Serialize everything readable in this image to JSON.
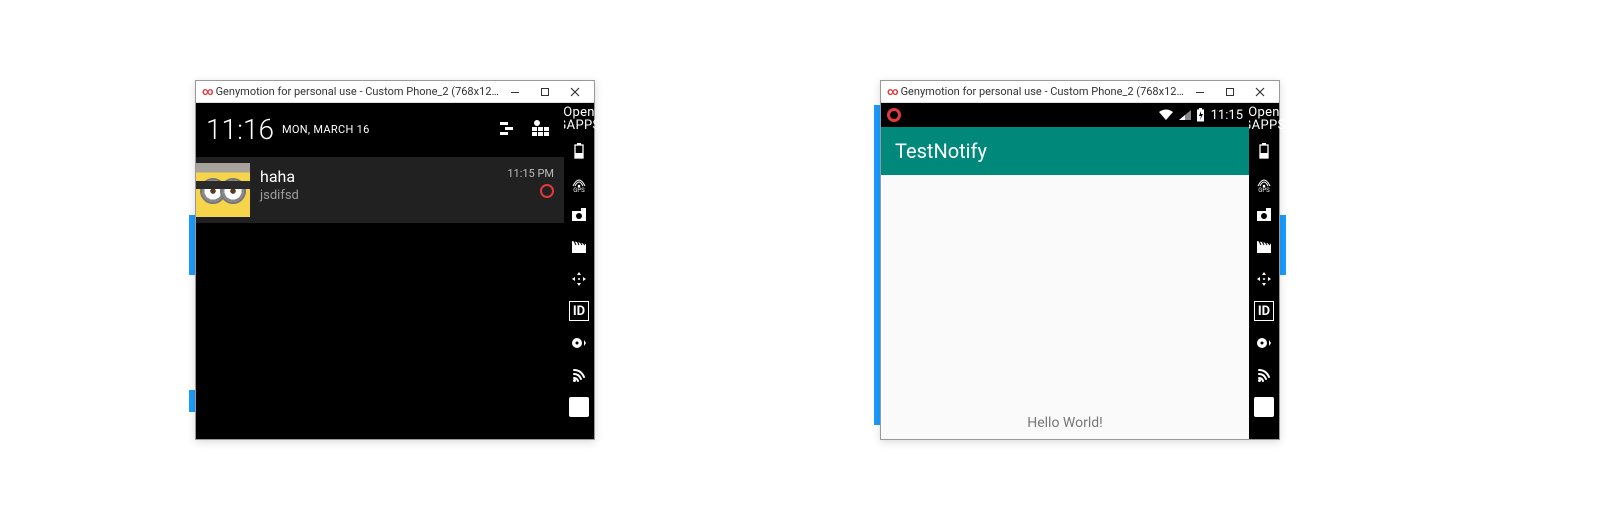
{
  "windowTitle": "Genymotion for personal use - Custom Phone_2 (768x1280, 320dp...",
  "left": {
    "time": "11:16",
    "date": "MON, MARCH 16",
    "notification": {
      "title": "haha",
      "text": "jsdifsd",
      "time": "11:15 PM"
    }
  },
  "right": {
    "statusTime": "11:15",
    "appTitle": "TestNotify",
    "bodyText": "Hello World!"
  },
  "sidebar": {
    "opengapps": "Open GAPPS",
    "gps": "GPS",
    "id": "ID"
  }
}
